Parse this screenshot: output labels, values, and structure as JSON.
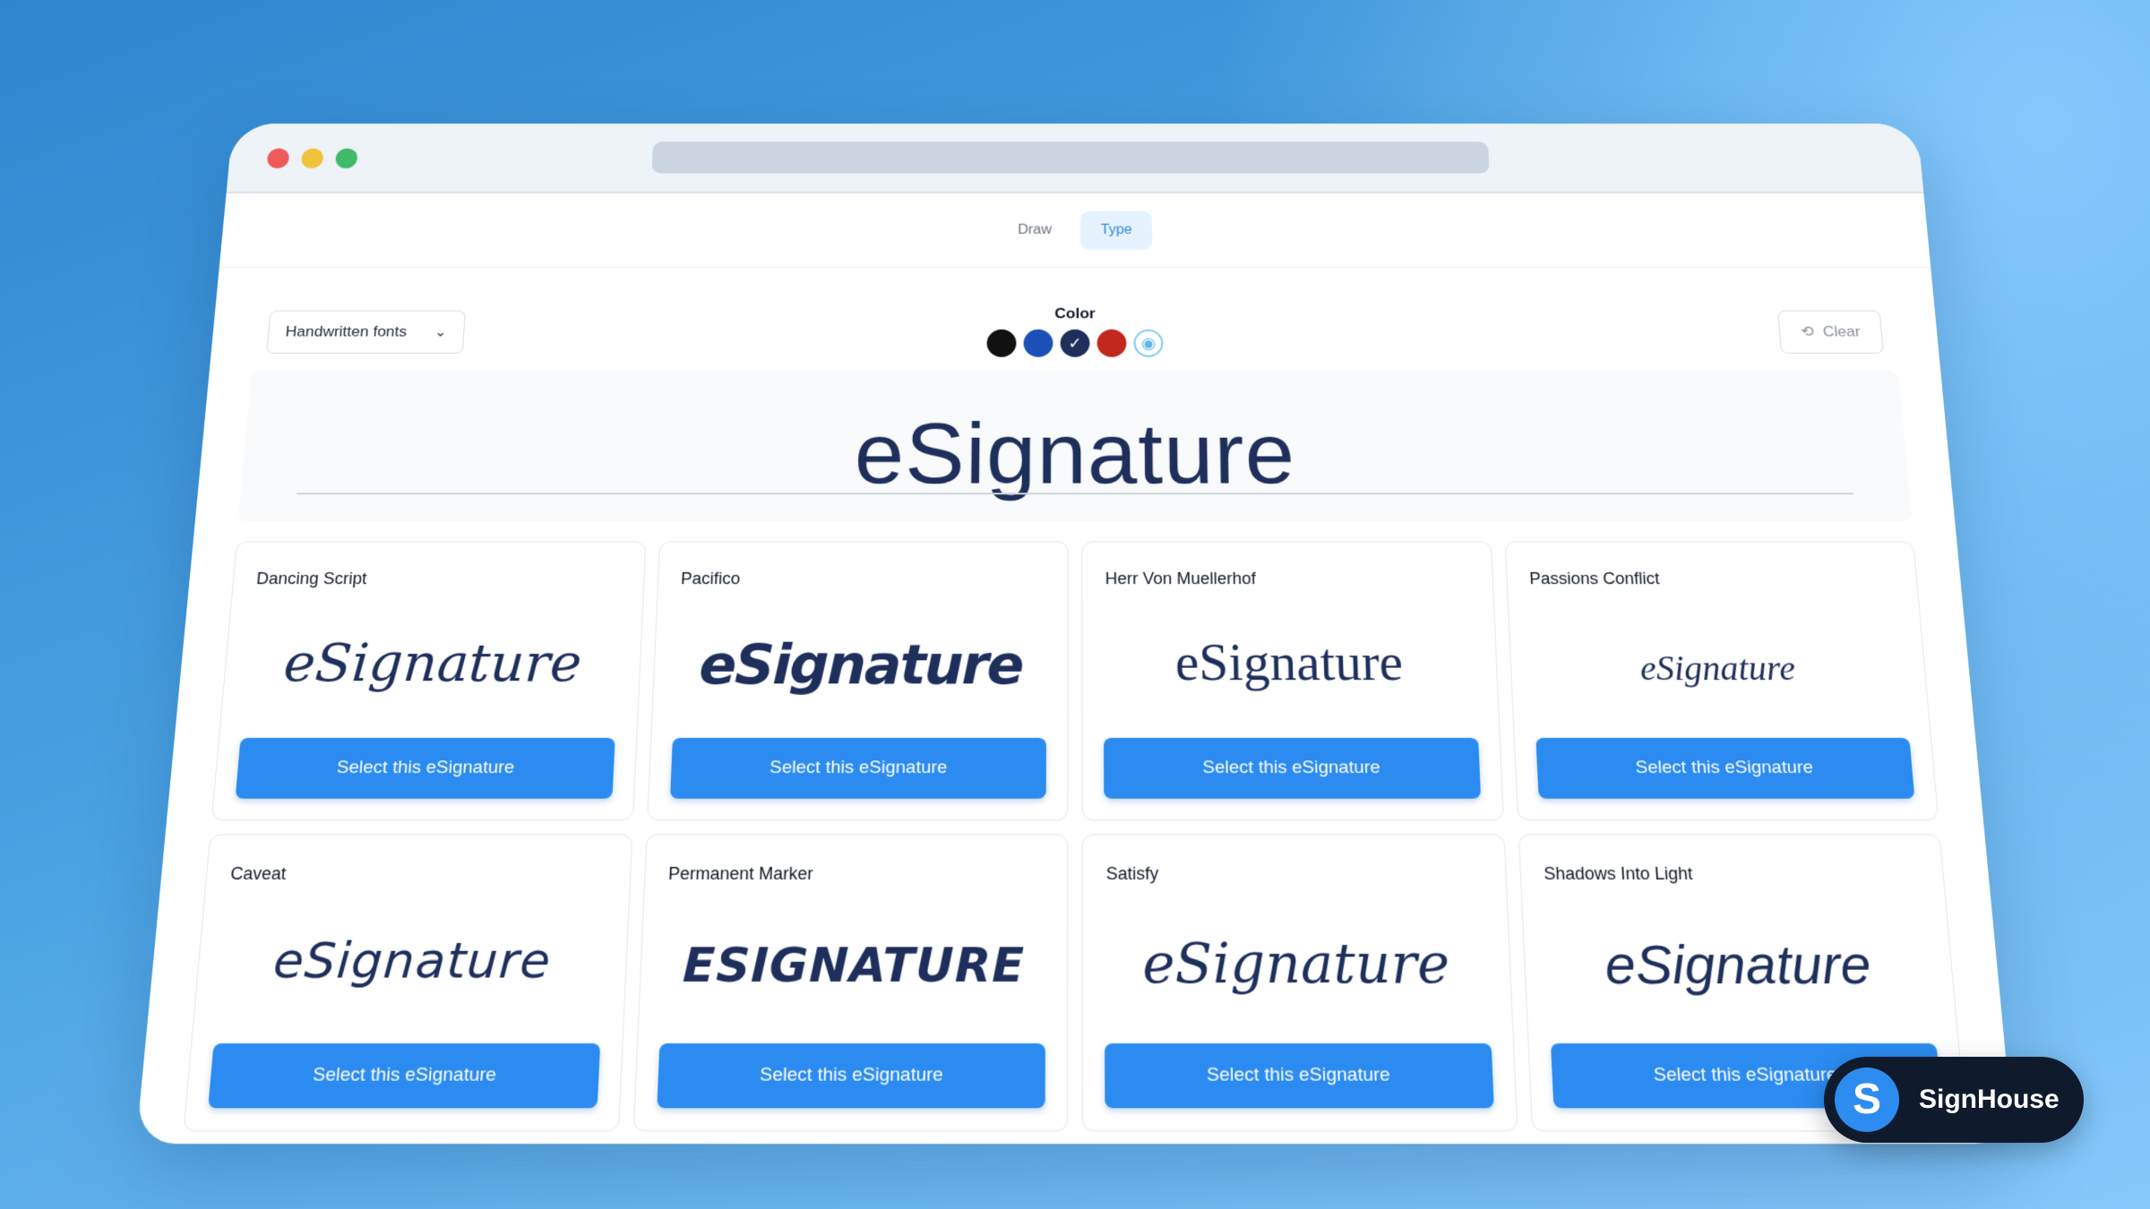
{
  "tabs": [
    {
      "label": "Draw",
      "active": false
    },
    {
      "label": "Type",
      "active": true
    }
  ],
  "toolbar": {
    "font_select": {
      "value": "Handwritten fonts",
      "icon": "chevron-down-icon"
    },
    "color_label": "Color",
    "colors": [
      {
        "name": "black",
        "hex": "#111111",
        "selected": false
      },
      {
        "name": "blue",
        "hex": "#1d4fb8",
        "selected": false
      },
      {
        "name": "navy",
        "hex": "#1e2f5c",
        "selected": true
      },
      {
        "name": "red",
        "hex": "#c2271d",
        "selected": false
      }
    ],
    "custom_color_icon": "palette-icon",
    "clear_label": "Clear",
    "clear_icon": "eraser-icon"
  },
  "preview": {
    "text": "eSignature",
    "color": "#1e2f5c"
  },
  "fonts": [
    {
      "name": "Dancing Script",
      "sample": "eSignature",
      "button": "Select this eSignature"
    },
    {
      "name": "Pacifico",
      "sample": "eSignature",
      "button": "Select this eSignature"
    },
    {
      "name": "Herr Von Muellerhof",
      "sample": "eSignature",
      "button": "Select this eSignature"
    },
    {
      "name": "Passions Conflict",
      "sample": "eSignature",
      "button": "Select this eSignature"
    },
    {
      "name": "Caveat",
      "sample": "eSignature",
      "button": "Select this eSignature"
    },
    {
      "name": "Permanent Marker",
      "sample": "ESIGNATURE",
      "button": "Select this eSignature"
    },
    {
      "name": "Satisfy",
      "sample": "eSignature",
      "button": "Select this eSignature"
    },
    {
      "name": "Shadows Into Light",
      "sample": "eSignature",
      "button": "Select this eSignature"
    }
  ],
  "brand": {
    "logo_letter": "S",
    "name": "SignHouse",
    "accent": "#2d8cf0"
  }
}
